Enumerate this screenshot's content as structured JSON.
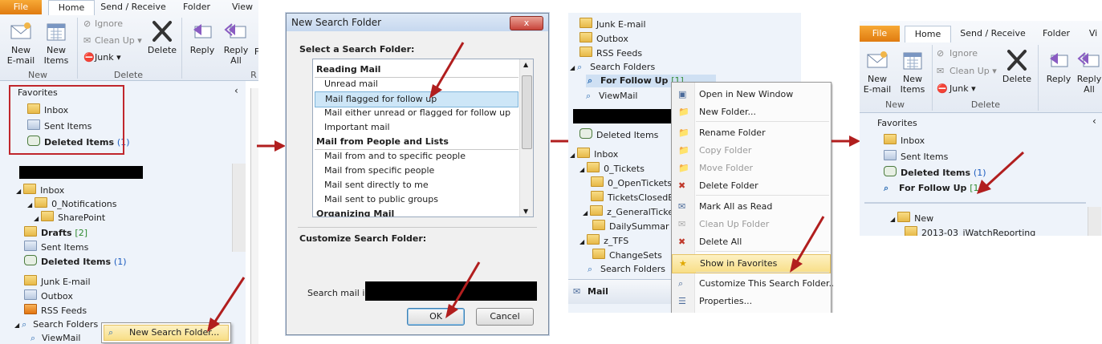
{
  "panel1": {
    "tabs": [
      "File",
      "Home",
      "Send / Receive",
      "Folder",
      "View"
    ],
    "ribbon": {
      "new_email": "New\nE-mail",
      "new_items": "New\nItems",
      "ignore": "Ignore",
      "clean_up": "Clean Up",
      "junk": "Junk",
      "delete": "Delete",
      "reply": "Reply",
      "reply_all": "Reply\nAll",
      "forward_partial": "F",
      "group_new": "New",
      "group_delete": "Delete",
      "group_respond_partial": "R"
    },
    "favorites_label": "Favorites",
    "favorites": [
      {
        "label": "Inbox"
      },
      {
        "label": "Sent Items"
      },
      {
        "label": "Deleted Items",
        "count": "(1)"
      }
    ],
    "tree": [
      {
        "label": "Inbox"
      },
      {
        "label": "0_Notifications"
      },
      {
        "label": "SharePoint"
      },
      {
        "label": "Drafts",
        "count": "[2]"
      },
      {
        "label": "Sent Items"
      },
      {
        "label": "Deleted Items",
        "count": "(1)"
      },
      {
        "label": "Junk E-mail"
      },
      {
        "label": "Outbox"
      },
      {
        "label": "RSS Feeds"
      },
      {
        "label": "Search Folders"
      },
      {
        "label": "ViewMail"
      }
    ],
    "context_item": "New Search Folder..."
  },
  "dialog": {
    "title": "New Search Folder",
    "close": "x",
    "select_label": "Select a Search Folder:",
    "list": [
      {
        "type": "cat",
        "label": "Reading Mail"
      },
      {
        "type": "item",
        "label": "Unread mail"
      },
      {
        "type": "item",
        "label": "Mail flagged for follow up",
        "selected": true
      },
      {
        "type": "item",
        "label": "Mail either unread or flagged for follow up"
      },
      {
        "type": "item",
        "label": "Important mail"
      },
      {
        "type": "cat",
        "label": "Mail from People and Lists"
      },
      {
        "type": "item",
        "label": "Mail from and to specific people"
      },
      {
        "type": "item",
        "label": "Mail from specific people"
      },
      {
        "type": "item",
        "label": "Mail sent directly to me"
      },
      {
        "type": "item",
        "label": "Mail sent to public groups"
      },
      {
        "type": "cat",
        "label": "Organizing Mail"
      }
    ],
    "customize_label": "Customize Search Folder:",
    "search_in_label": "Search mail in:",
    "ok": "OK",
    "cancel": "Cancel"
  },
  "panel3": {
    "tree": [
      {
        "label": "Junk E-mail"
      },
      {
        "label": "Outbox"
      },
      {
        "label": "RSS Feeds"
      },
      {
        "label": "Search Folders"
      },
      {
        "label": "For Follow Up",
        "count": "[1]"
      },
      {
        "label": "ViewMail"
      },
      {
        "label": "Deleted Items"
      },
      {
        "label": "Inbox"
      },
      {
        "label": "0_Tickets"
      },
      {
        "label": "0_OpenTickets"
      },
      {
        "label": "TicketsClosedE"
      },
      {
        "label": "z_GeneralTicke"
      },
      {
        "label": "DailySummar"
      },
      {
        "label": "z_TFS"
      },
      {
        "label": "ChangeSets"
      },
      {
        "label": "Search Folders"
      }
    ],
    "mail_label": "Mail",
    "menu": [
      {
        "label": "Open in New Window",
        "disabled": false
      },
      {
        "label": "New Folder...",
        "disabled": false
      },
      {
        "label": "Rename Folder",
        "disabled": false
      },
      {
        "label": "Copy Folder",
        "disabled": true
      },
      {
        "label": "Move Folder",
        "disabled": true
      },
      {
        "label": "Delete Folder",
        "disabled": false
      },
      {
        "label": "Mark All as Read",
        "disabled": false
      },
      {
        "label": "Clean Up Folder",
        "disabled": true
      },
      {
        "label": "Delete All",
        "disabled": false
      },
      {
        "label": "Show in Favorites",
        "disabled": false,
        "highlight": true
      },
      {
        "label": "Customize This Search Folder...",
        "disabled": false
      },
      {
        "label": "Properties...",
        "disabled": false
      }
    ]
  },
  "panel4": {
    "tabs": [
      "File",
      "Home",
      "Send / Receive",
      "Folder",
      "Vi"
    ],
    "ribbon": {
      "new_email": "New\nE-mail",
      "new_items": "New\nItems",
      "ignore": "Ignore",
      "clean_up": "Clean Up",
      "junk": "Junk",
      "delete": "Delete",
      "reply": "Reply",
      "reply_all": "Reply\nAll",
      "group_new": "New",
      "group_delete": "Delete"
    },
    "favorites_label": "Favorites",
    "favorites": [
      {
        "label": "Inbox"
      },
      {
        "label": "Sent Items"
      },
      {
        "label": "Deleted Items",
        "count": "(1)"
      },
      {
        "label": "For Follow Up",
        "count": "[1]"
      }
    ],
    "tree": [
      {
        "label": "New"
      },
      {
        "label": "2013-03_iWatchReporting"
      }
    ]
  },
  "colors": {
    "accent_red": "#b11e1e",
    "file_tab": "#e88a1a",
    "nav_bg": "#eef3fa",
    "selection": "#cde6f7",
    "menu_highlight": "#f8de86"
  }
}
